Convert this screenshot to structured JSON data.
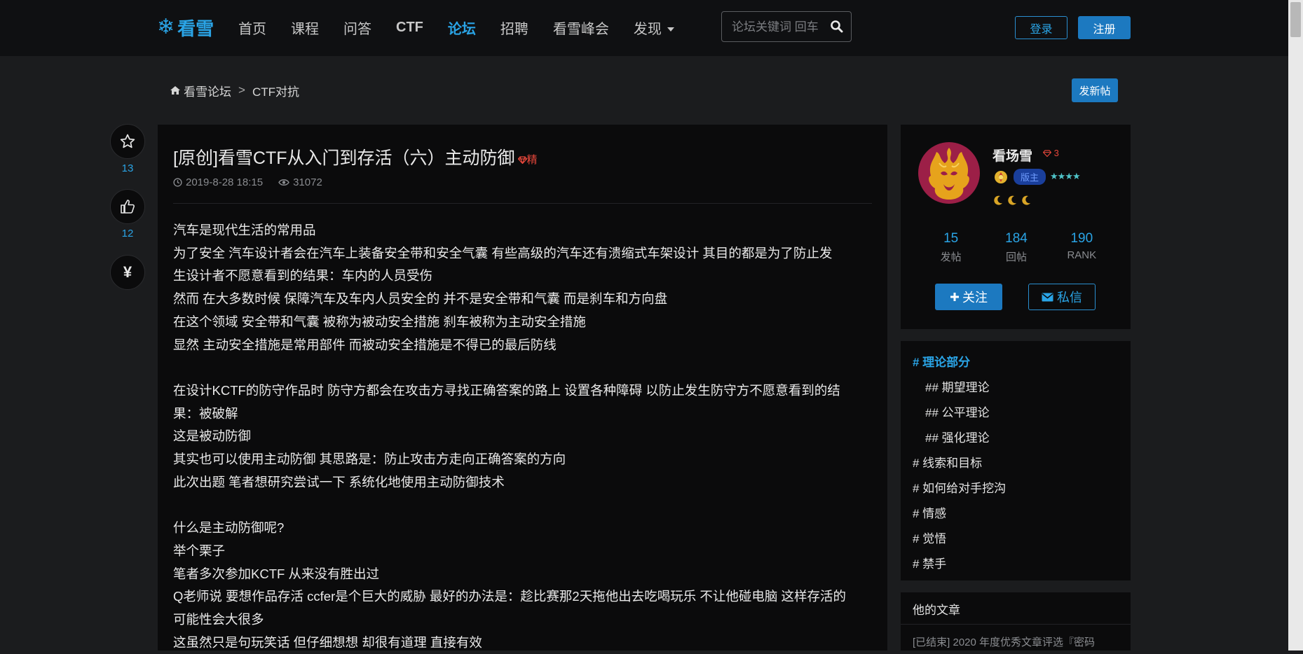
{
  "nav": {
    "logo": "看雪",
    "items": [
      "首页",
      "课程",
      "问答",
      "CTF",
      "论坛",
      "招聘",
      "看雪峰会",
      "发现"
    ],
    "active_item": "论坛",
    "search_placeholder": "论坛关键词 回车",
    "login": "登录",
    "register": "注册"
  },
  "breadcrumb": {
    "home": "看雪论坛",
    "separator": ">",
    "section": "CTF对抗"
  },
  "new_post": "发新帖",
  "actions": {
    "favorite_count": "13",
    "like_count": "12",
    "reward_symbol": "¥"
  },
  "post": {
    "title": "[原创]看雪CTF从入门到存活（六）主动防御",
    "badge": "精",
    "date": "2019-8-28 18:15",
    "views": "31072",
    "lines": [
      "汽车是现代生活的常用品",
      "为了安全 汽车设计者会在汽车上装备安全带和安全气囊 有些高级的汽车还有溃缩式车架设计 其目的都是为了防止发",
      "生设计者不愿意看到的结果：车内的人员受伤",
      "然而 在大多数时候 保障汽车及车内人员安全的 并不是安全带和气囊 而是刹车和方向盘",
      "在这个领域 安全带和气囊 被称为被动安全措施 刹车被称为主动安全措施",
      "显然 主动安全措施是常用部件 而被动安全措施是不得已的最后防线",
      "",
      "在设计KCTF的防守作品时 防守方都会在攻击方寻找正确答案的路上 设置各种障碍 以防止发生防守方不愿意看到的结",
      "果：被破解",
      "这是被动防御",
      "其实也可以使用主动防御 其思路是：防止攻击方走向正确答案的方向",
      "此次出题 笔者想研究尝试一下 系统化地使用主动防御技术",
      "",
      "什么是主动防御呢?",
      "举个栗子",
      "笔者多次参加KCTF 从来没有胜出过",
      "Q老师说 要想作品存活 ccfer是个巨大的威胁 最好的办法是：趁比赛那2天拖他出去吃喝玩乐 不让他碰电脑 这样存活的",
      "可能性会大很多",
      "这虽然只是句玩笑话 但仔细想想 却很有道理 直接有效"
    ]
  },
  "author": {
    "name": "看场雪",
    "level": "3",
    "role_badge": "版主",
    "stars": "★★★★",
    "stats": [
      {
        "num": "15",
        "label": "发帖"
      },
      {
        "num": "184",
        "label": "回帖"
      },
      {
        "num": "190",
        "label": "RANK"
      }
    ],
    "follow": "关注",
    "message": "私信"
  },
  "toc": [
    {
      "text": "# 理论部分",
      "level": 1,
      "active": true
    },
    {
      "text": "## 期望理论",
      "level": 2
    },
    {
      "text": "## 公平理论",
      "level": 2
    },
    {
      "text": "## 强化理论",
      "level": 2
    },
    {
      "text": "# 线索和目标",
      "level": 1
    },
    {
      "text": "# 如何给对手挖沟",
      "level": 1
    },
    {
      "text": "# 情感",
      "level": 1
    },
    {
      "text": "# 觉悟",
      "level": 1
    },
    {
      "text": "# 禁手",
      "level": 1
    }
  ],
  "articles": {
    "heading": "他的文章",
    "items": [
      "[已结束] 2020 年度优秀文章评选『密码"
    ]
  },
  "colors": {
    "accent": "#2aa4e6",
    "button": "#1c79c0",
    "essence": "#e8473b",
    "background": "#1b1c1e",
    "card": "#0b0b0c"
  }
}
